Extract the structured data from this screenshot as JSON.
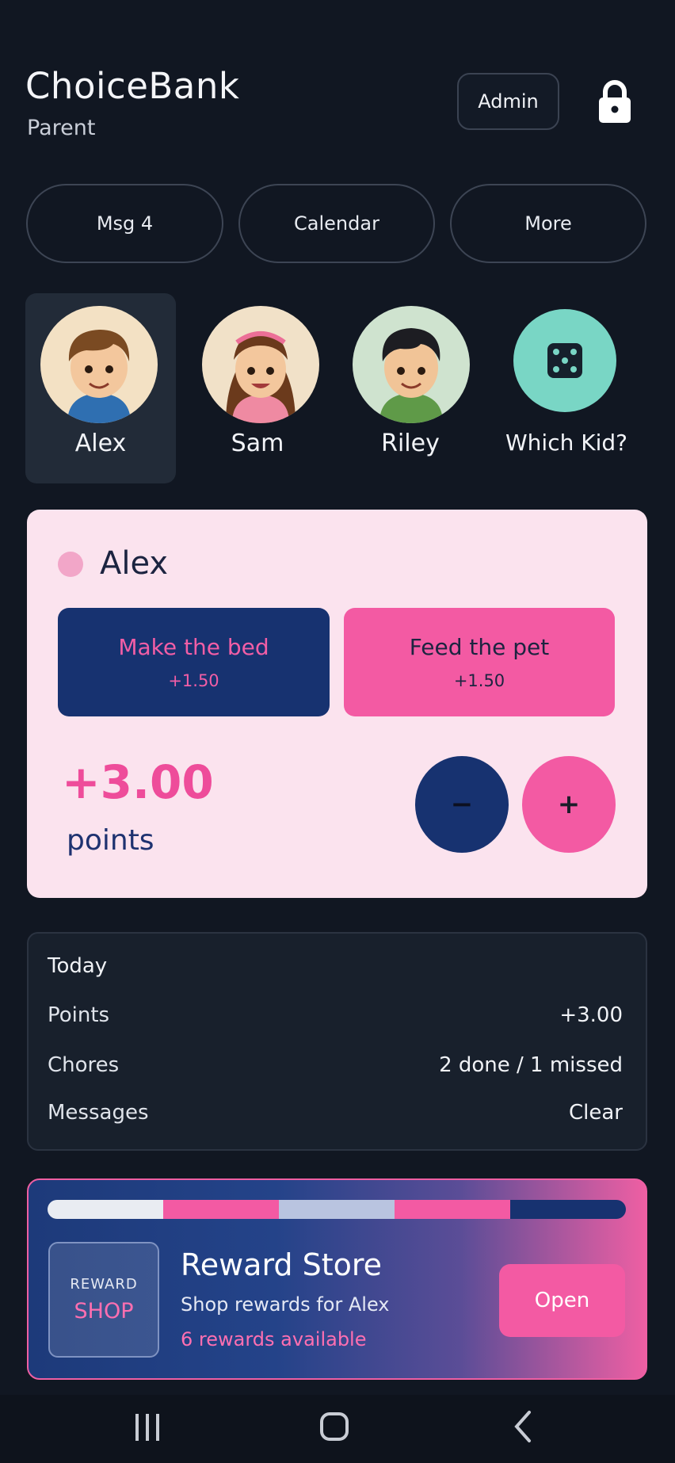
{
  "header": {
    "title": "ChoiceBank",
    "subtitle": "Parent",
    "admin_label": "Admin",
    "lock_icon": "lock-icon"
  },
  "nav": {
    "pills": [
      {
        "label": "Msg 4"
      },
      {
        "label": "Calendar"
      },
      {
        "label": "More"
      }
    ]
  },
  "kids": [
    {
      "name": "Alex",
      "selected": true
    },
    {
      "name": "Sam",
      "selected": false
    },
    {
      "name": "Riley",
      "selected": false
    },
    {
      "name": "Which Kid?",
      "icon": "dice-icon",
      "selected": false
    }
  ],
  "card": {
    "kid_name": "Alex",
    "chores": [
      {
        "title": "Make the bed",
        "points": "+1.50"
      },
      {
        "title": "Feed the pet",
        "points": "+1.50"
      }
    ],
    "total": "+3.00",
    "total_label": "points",
    "minus_label": "−",
    "plus_label": "+"
  },
  "today": {
    "heading": "Today",
    "rows": [
      {
        "label": "Points",
        "value": "+3.00"
      },
      {
        "label": "Chores",
        "value": "2 done / 1 missed"
      },
      {
        "label": "Messages",
        "value": "Clear"
      }
    ]
  },
  "store": {
    "tile_top": "REWARD",
    "tile_bottom": "SHOP",
    "title": "Reward Store",
    "description": "Shop rewards for Alex",
    "count": "6 rewards available",
    "open_label": "Open"
  },
  "colors": {
    "background": "#111722",
    "card_bg": "#fbe3ee",
    "navy": "#173270",
    "pink": "#f35aa3"
  }
}
